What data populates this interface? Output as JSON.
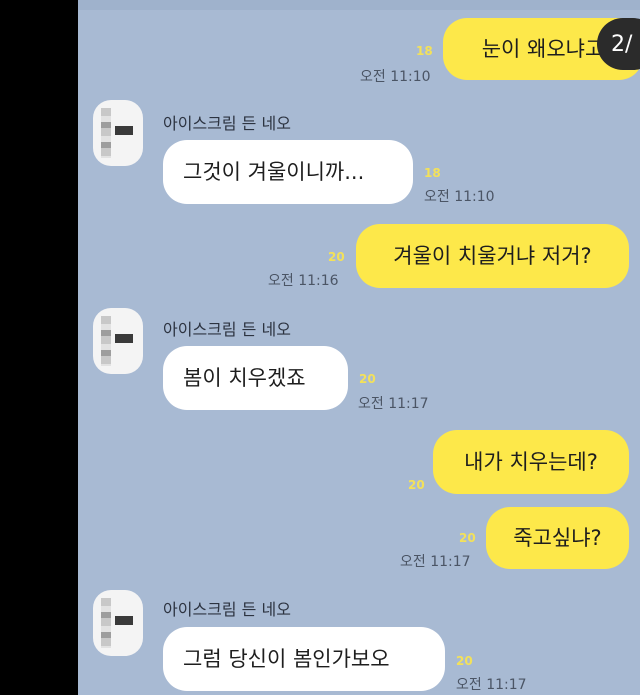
{
  "page_indicator": "2/",
  "messages": [
    {
      "side": "out",
      "text": "눈이 왜오냐고",
      "unread": "18",
      "time": "오전 11:10"
    },
    {
      "side": "in",
      "sender": "아이스크림 든 네오",
      "text": "그것이 겨울이니까...",
      "unread": "18",
      "time": "오전 11:10"
    },
    {
      "side": "out",
      "text": "겨울이 치울거냐 저거?",
      "unread": "20",
      "time": "오전 11:16"
    },
    {
      "side": "in",
      "sender": "아이스크림 든 네오",
      "text": "봄이 치우겠죠",
      "unread": "20",
      "time": "오전 11:17"
    },
    {
      "side": "out",
      "text": "내가 치우는데?",
      "unread": "20",
      "time": ""
    },
    {
      "side": "out",
      "text": "죽고싶냐?",
      "unread": "20",
      "time": "오전 11:17"
    },
    {
      "side": "in",
      "sender": "아이스크림 든 네오",
      "text": "그럼 당신이 봄인가보오",
      "unread": "20",
      "time": "오전 11:17"
    }
  ],
  "colors": {
    "chat_bg": "#a8bad3",
    "outgoing_bubble": "#fde84a",
    "incoming_bubble": "#ffffff",
    "unread_count": "#f3e15a"
  }
}
